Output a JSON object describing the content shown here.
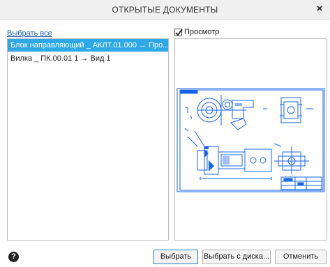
{
  "window": {
    "title": "ОТКРЫТЫЕ ДОКУМЕНТЫ",
    "close_icon": "×"
  },
  "list": {
    "select_all_label": "Выбрать все",
    "items": [
      {
        "label": "Блок направляющий  _ АКЛТ.01.000 → Про...",
        "selected": true
      },
      {
        "label": "Вилка _ ПК.00.01 1  → Вид 1",
        "selected": false
      }
    ]
  },
  "preview": {
    "label": "Просмотр",
    "checked": true
  },
  "footer": {
    "help_icon": "?",
    "select_label": "Выбрать",
    "select_from_disk_label": "Выбрать с диска...",
    "cancel_label": "Отменить"
  },
  "colors": {
    "selection": "#2ea8e6",
    "link": "#1a5fb4",
    "drawing": "#1565e8"
  }
}
